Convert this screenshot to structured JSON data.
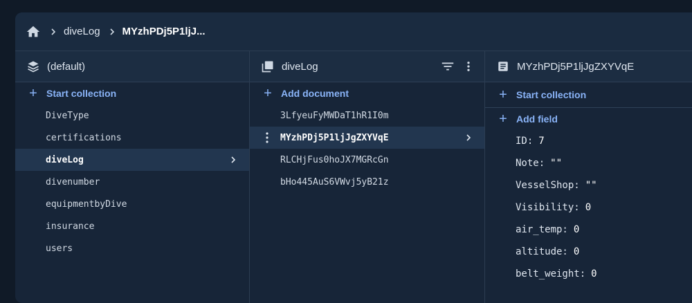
{
  "breadcrumb": {
    "items": [
      {
        "label": "diveLog"
      },
      {
        "label": "MYzhPDj5P1ljJ..."
      }
    ]
  },
  "columns": {
    "root": {
      "title": "(default)",
      "action": "Start collection",
      "items": [
        "DiveType",
        "certifications",
        "diveLog",
        "divenumber",
        "equipmentbyDive",
        "insurance",
        "users"
      ],
      "selected_index": 2
    },
    "collection": {
      "title": "diveLog",
      "action": "Add document",
      "items": [
        "3LfyeuFyMWDaT1hR1I0m",
        "MYzhPDj5P1ljJgZXYVqE",
        "RLCHjFus0hoJX7MGRcGn",
        "bHo445AuS6VWvj5yB21z"
      ],
      "selected_index": 1
    },
    "document": {
      "title": "MYzhPDj5P1ljJgZXYVqE",
      "action_collection": "Start collection",
      "action_field": "Add field",
      "fields": [
        {
          "key": "ID:",
          "value": "7"
        },
        {
          "key": "Note:",
          "value": "\"\""
        },
        {
          "key": "VesselShop:",
          "value": "\"\""
        },
        {
          "key": "Visibility:",
          "value": "0"
        },
        {
          "key": "air_temp:",
          "value": "0"
        },
        {
          "key": "altitude:",
          "value": "0"
        },
        {
          "key": "belt_weight:",
          "value": "0"
        }
      ]
    }
  },
  "icons": {
    "home": "home-icon",
    "breadcrumb_separator": "chevron-right-icon",
    "database": "database-stack-icon",
    "collection": "collection-icon",
    "document": "document-icon",
    "filter": "filter-icon",
    "more": "more-vert-icon"
  },
  "colors": {
    "background": "#101a27",
    "panel": "#172538",
    "accent": "#8ab4f8",
    "selected_row": "#22364f"
  }
}
